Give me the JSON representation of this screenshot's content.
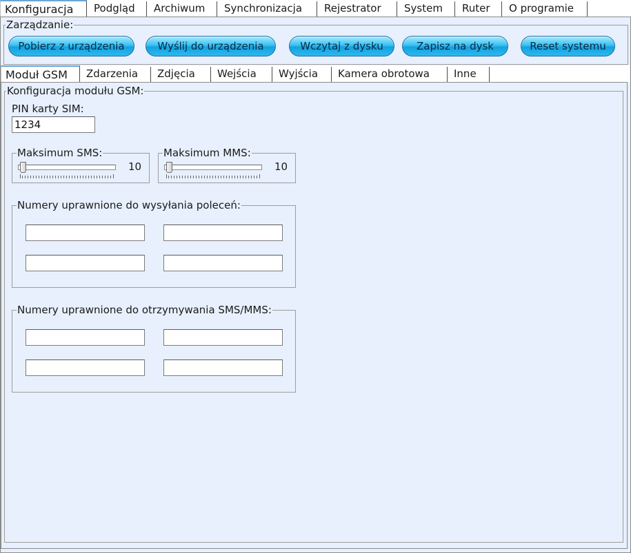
{
  "top_tabs": [
    "Konfiguracja",
    "Podgląd",
    "Archiwum",
    "Synchronizacja",
    "Rejestrator",
    "System",
    "Ruter",
    "O programie"
  ],
  "management": {
    "legend": "Zarządzanie:",
    "buttons": [
      "Pobierz z urządzenia",
      "Wyślij do urządzenia",
      "Wczytaj z dysku",
      "Zapisz na dysk",
      "Reset systemu"
    ]
  },
  "sub_tabs": [
    "Moduł GSM",
    "Zdarzenia",
    "Zdjęcia",
    "Wejścia",
    "Wyjścia",
    "Kamera obrotowa",
    "Inne"
  ],
  "gsm": {
    "legend": "Konfiguracja modułu GSM:",
    "pin_label": "PIN karty SIM:",
    "pin_value": "1234",
    "max_sms": {
      "label": "Maksimum SMS:",
      "value": "10"
    },
    "max_mms": {
      "label": "Maksimum MMS:",
      "value": "10"
    },
    "command_numbers": {
      "legend": "Numery uprawnione do wysyłania poleceń:",
      "values": [
        "",
        "",
        "",
        ""
      ]
    },
    "receive_numbers": {
      "legend": "Numery uprawnione do otrzymywania SMS/MMS:",
      "values": [
        "",
        "",
        "",
        ""
      ]
    }
  },
  "colors": {
    "panel_bg": "#e7f0fc",
    "button_blue": "#12a2e0",
    "tab_accent": "#6aa6d8"
  }
}
